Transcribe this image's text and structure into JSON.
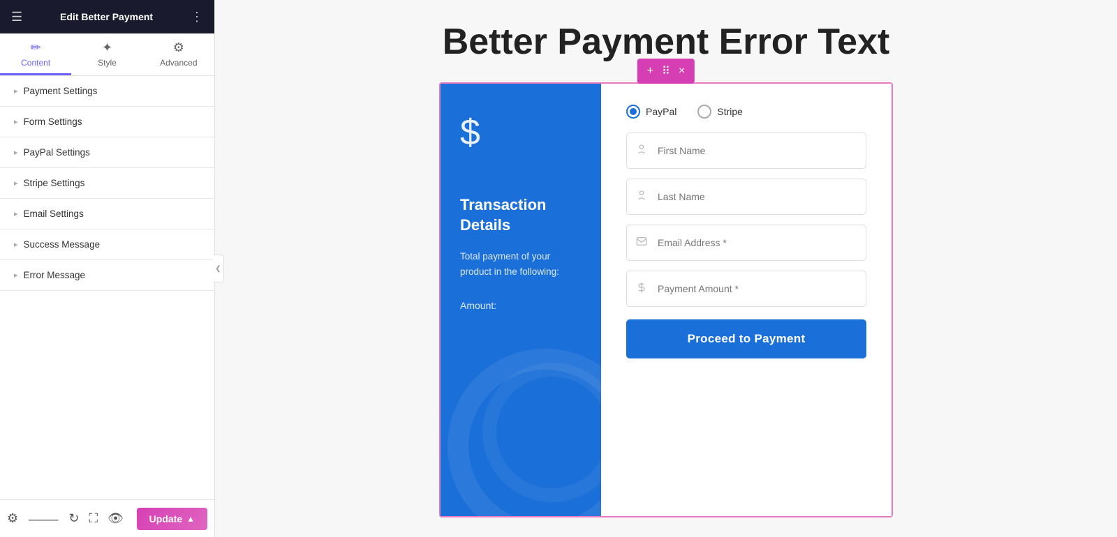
{
  "sidebar": {
    "header": {
      "title": "Edit Better Payment",
      "menu_icon": "≡",
      "grid_icon": "⊞"
    },
    "tabs": [
      {
        "id": "content",
        "label": "Content",
        "icon": "✏️",
        "active": true
      },
      {
        "id": "style",
        "label": "Style",
        "icon": "🎨",
        "active": false
      },
      {
        "id": "advanced",
        "label": "Advanced",
        "icon": "⚙️",
        "active": false
      }
    ],
    "menu_items": [
      {
        "id": "payment-settings",
        "label": "Payment Settings"
      },
      {
        "id": "form-settings",
        "label": "Form Settings"
      },
      {
        "id": "paypal-settings",
        "label": "PayPal Settings"
      },
      {
        "id": "stripe-settings",
        "label": "Stripe Settings"
      },
      {
        "id": "email-settings",
        "label": "Email Settings"
      },
      {
        "id": "success-message",
        "label": "Success Message"
      },
      {
        "id": "error-message",
        "label": "Error Message"
      }
    ],
    "footer": {
      "update_label": "Update",
      "icons": [
        "gear",
        "layers",
        "history",
        "crop",
        "eye"
      ]
    }
  },
  "main": {
    "page_title": "Better Payment Error Text",
    "widget": {
      "toolbar": {
        "add_icon": "+",
        "move_icon": "⠿",
        "close_icon": "×"
      },
      "left_panel": {
        "dollar_sign": "$",
        "transaction_title": "Transaction Details",
        "transaction_desc": "Total payment of your product in the following:",
        "amount_label": "Amount:"
      },
      "right_panel": {
        "payment_methods": [
          {
            "id": "paypal",
            "label": "PayPal",
            "selected": true
          },
          {
            "id": "stripe",
            "label": "Stripe",
            "selected": false
          }
        ],
        "fields": [
          {
            "id": "first-name",
            "placeholder": "First Name",
            "icon": "person"
          },
          {
            "id": "last-name",
            "placeholder": "Last Name",
            "icon": "person"
          },
          {
            "id": "email",
            "placeholder": "Email Address *",
            "icon": "mail"
          },
          {
            "id": "payment-amount",
            "placeholder": "Payment Amount *",
            "icon": "dollar"
          }
        ],
        "submit_button": "Proceed to Payment"
      }
    }
  }
}
